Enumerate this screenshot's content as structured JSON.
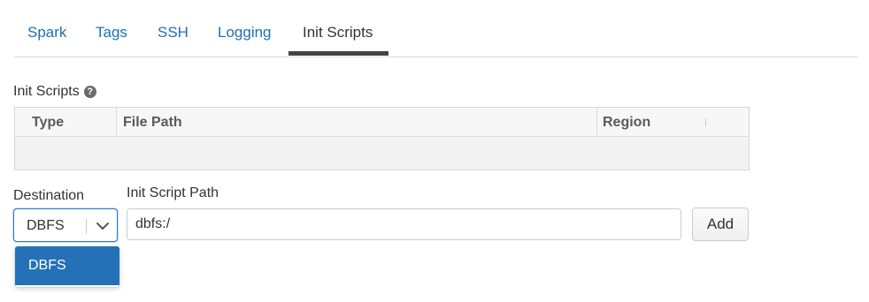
{
  "tabs": [
    {
      "label": "Spark"
    },
    {
      "label": "Tags"
    },
    {
      "label": "SSH"
    },
    {
      "label": "Logging"
    },
    {
      "label": "Init Scripts",
      "active": true
    }
  ],
  "section": {
    "title": "Init Scripts",
    "help_icon": "question-circle-icon"
  },
  "table": {
    "columns": [
      "Type",
      "File Path",
      "Region"
    ],
    "rows": []
  },
  "form": {
    "destination_label": "Destination",
    "destination_value": "DBFS",
    "destination_options": [
      "DBFS"
    ],
    "path_label": "Init Script Path",
    "path_value": "dbfs:/",
    "add_label": "Add"
  },
  "colors": {
    "link": "#1f6fb2",
    "accent": "#2471b8",
    "active_tab_underline": "#444444"
  }
}
